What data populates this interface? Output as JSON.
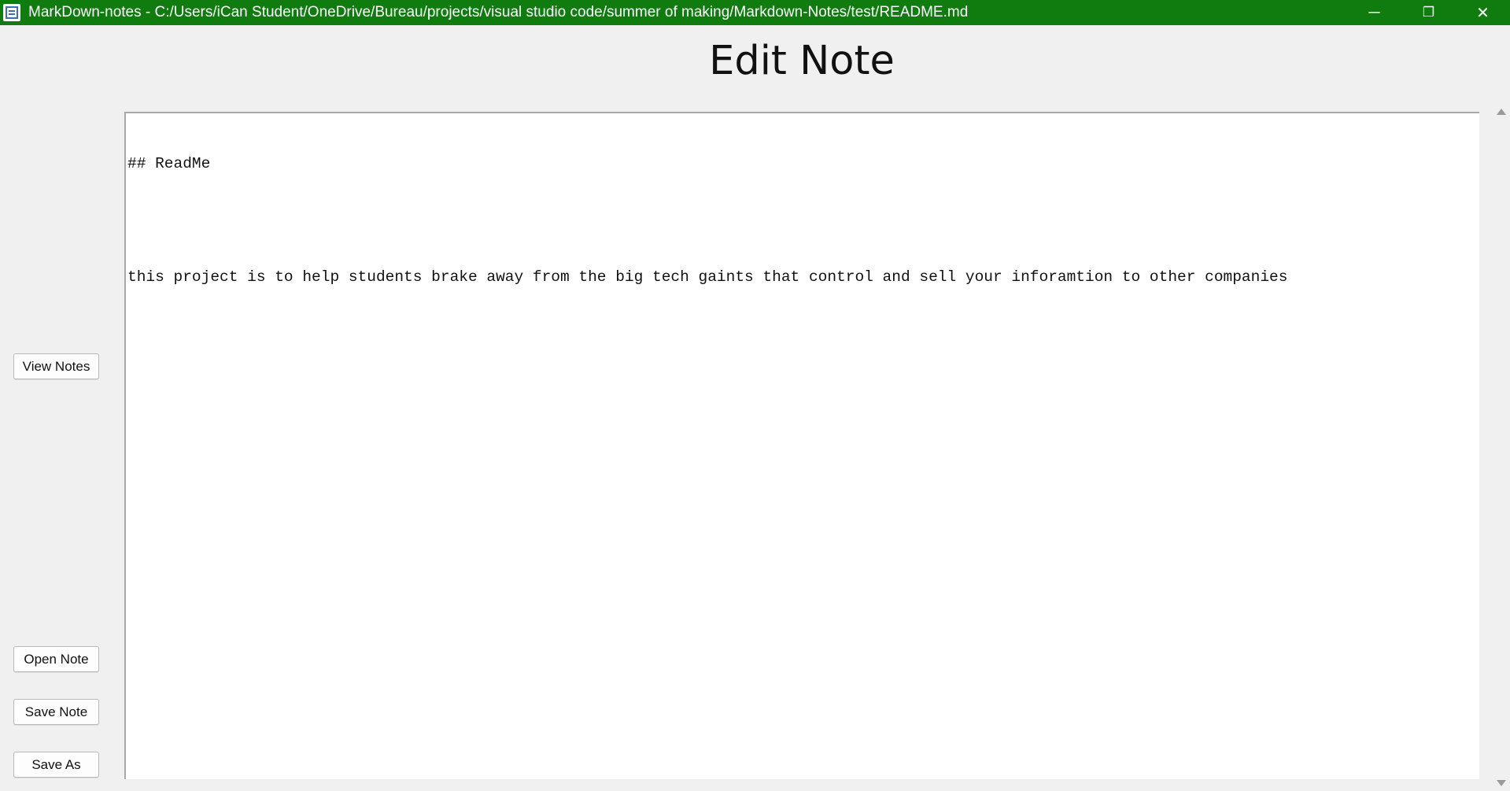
{
  "window": {
    "title": "MarkDown-notes - C:/Users/iCan Student/OneDrive/Bureau/projects/visual studio code/summer of making/Markdown-Notes/test/README.md",
    "icon": "notes-app-icon",
    "minimize_glyph": "─",
    "restore_glyph": "❐",
    "close_glyph": "✕",
    "titlebar_color": "#107c10"
  },
  "page": {
    "heading": "Edit Note"
  },
  "sidebar": {
    "view_notes_label": "View Notes",
    "open_note_label": "Open Note",
    "save_note_label": "Save Note",
    "save_as_label": "Save As"
  },
  "editor": {
    "lines": [
      "## ReadMe",
      "",
      "this project is to help students brake away from the big tech gaints that control and sell your inforamtion to other companies"
    ]
  }
}
